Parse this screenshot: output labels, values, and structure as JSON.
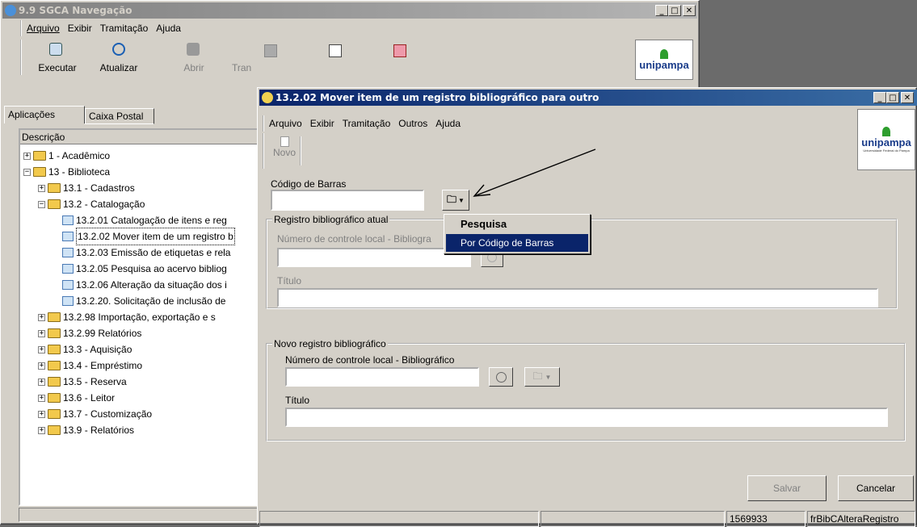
{
  "main": {
    "title": "9.9 SGCA Navegação",
    "menu": [
      "Arquivo",
      "Exibir",
      "Tramitação",
      "Ajuda"
    ],
    "toolbar": [
      "Executar",
      "Atualizar",
      "Abrir",
      "Tran"
    ],
    "logo": "unipampa",
    "tabs": [
      "Aplicações",
      "Caixa Postal"
    ],
    "tree_header": "Descrição",
    "tree": [
      {
        "label": "1 - Acadêmico",
        "indent": 0,
        "type": "folder",
        "exp": "+"
      },
      {
        "label": "13 - Biblioteca",
        "indent": 0,
        "type": "folder",
        "exp": "-"
      },
      {
        "label": "13.1 - Cadastros",
        "indent": 1,
        "type": "folder",
        "exp": "+"
      },
      {
        "label": "13.2 - Catalogação",
        "indent": 1,
        "type": "folder",
        "exp": "-"
      },
      {
        "label": "13.2.01 Catalogação de itens e reg",
        "indent": 2,
        "type": "doc",
        "exp": ""
      },
      {
        "label": "13.2.02 Mover item de um registro b",
        "indent": 2,
        "type": "doc",
        "exp": "",
        "selected": true
      },
      {
        "label": "13.2.03 Emissão de etiquetas e rela",
        "indent": 2,
        "type": "doc",
        "exp": ""
      },
      {
        "label": "13.2.05 Pesquisa ao acervo bibliog",
        "indent": 2,
        "type": "doc",
        "exp": ""
      },
      {
        "label": "13.2.06 Alteração da situação dos i",
        "indent": 2,
        "type": "doc",
        "exp": ""
      },
      {
        "label": "13.2.20. Solicitação de inclusão de",
        "indent": 2,
        "type": "doc",
        "exp": ""
      },
      {
        "label": "13.2.98 Importação, exportação e s",
        "indent": 1,
        "type": "folder",
        "exp": "+"
      },
      {
        "label": "13.2.99 Relatórios",
        "indent": 1,
        "type": "folder",
        "exp": "+"
      },
      {
        "label": "13.3 - Aquisição",
        "indent": 1,
        "type": "folder",
        "exp": "+"
      },
      {
        "label": "13.4 - Empréstimo",
        "indent": 1,
        "type": "folder",
        "exp": "+"
      },
      {
        "label": "13.5 - Reserva",
        "indent": 1,
        "type": "folder",
        "exp": "+"
      },
      {
        "label": "13.6 - Leitor",
        "indent": 1,
        "type": "folder",
        "exp": "+"
      },
      {
        "label": "13.7 - Customização",
        "indent": 1,
        "type": "folder",
        "exp": "+"
      },
      {
        "label": "13.9 - Relatórios",
        "indent": 1,
        "type": "folder",
        "exp": "+"
      }
    ]
  },
  "child": {
    "title": "13.2.02 Mover item de um registro bibliográfico para outro",
    "menu": [
      "Arquivo",
      "Exibir",
      "Tramitação",
      "Outros",
      "Ajuda"
    ],
    "toolbar_new": "Novo",
    "logo": "unipampa",
    "logo_sub": "Universidade Federal do Pampa",
    "barcode_label": "Código de Barras",
    "barcode_value": "",
    "group1": {
      "title": "Registro bibliográfico atual",
      "num_label": "Número de controle local - Bibliogra",
      "title_label": "Título"
    },
    "group2": {
      "title": "Novo registro bibliográfico",
      "num_label": "Número de controle local - Bibliográfico",
      "title_label": "Título"
    },
    "dropdown": {
      "header": "Pesquisa",
      "item": "Por Código de Barras"
    },
    "save": "Salvar",
    "cancel": "Cancelar",
    "status": [
      "",
      "",
      "1569933",
      "frBibCAlteraRegistro"
    ]
  }
}
